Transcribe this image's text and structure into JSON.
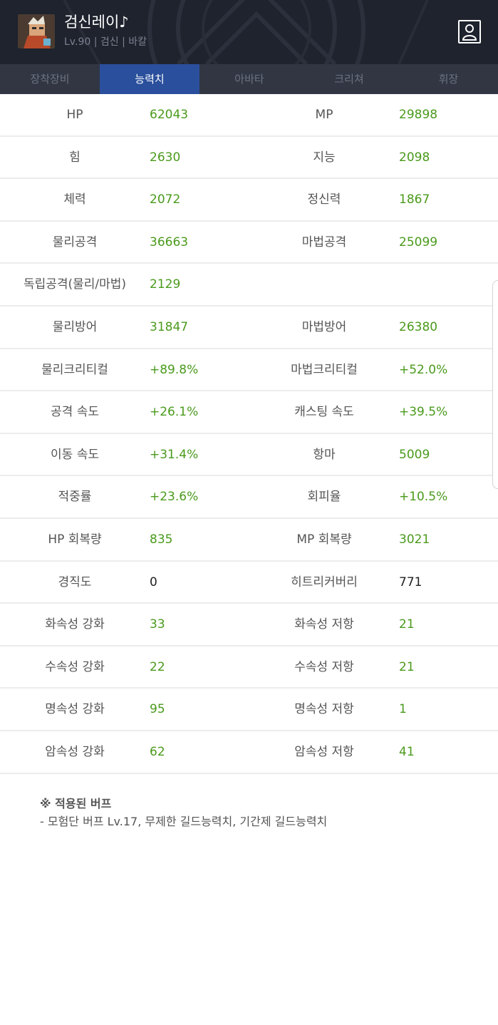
{
  "header": {
    "character_name": "검신레이♪",
    "character_info": "Lv.90 | 검신 | 바칼",
    "profile_icon": "profile-icon",
    "avatar_icon": "character-avatar"
  },
  "tabs": [
    {
      "label": "장착장비",
      "active": false
    },
    {
      "label": "능력치",
      "active": true
    },
    {
      "label": "아바타",
      "active": false
    },
    {
      "label": "크리쳐",
      "active": false
    },
    {
      "label": "휘장",
      "active": false
    }
  ],
  "stats": [
    {
      "l_label": "HP",
      "l_value": "62043",
      "r_label": "MP",
      "r_value": "29898"
    },
    {
      "l_label": "힘",
      "l_value": "2630",
      "r_label": "지능",
      "r_value": "2098"
    },
    {
      "l_label": "체력",
      "l_value": "2072",
      "r_label": "정신력",
      "r_value": "1867"
    },
    {
      "l_label": "물리공격",
      "l_value": "36663",
      "r_label": "마법공격",
      "r_value": "25099"
    },
    {
      "l_label": "독립공격(물리/마법)",
      "l_value": "2129",
      "r_label": "",
      "r_value": ""
    },
    {
      "l_label": "물리방어",
      "l_value": "31847",
      "r_label": "마법방어",
      "r_value": "26380"
    },
    {
      "l_label": "물리크리티컬",
      "l_value": "+89.8%",
      "r_label": "마법크리티컬",
      "r_value": "+52.0%"
    },
    {
      "l_label": "공격 속도",
      "l_value": "+26.1%",
      "r_label": "캐스팅 속도",
      "r_value": "+39.5%"
    },
    {
      "l_label": "이동 속도",
      "l_value": "+31.4%",
      "r_label": "항마",
      "r_value": "5009"
    },
    {
      "l_label": "적중률",
      "l_value": "+23.6%",
      "r_label": "회피율",
      "r_value": "+10.5%"
    },
    {
      "l_label": "HP 회복량",
      "l_value": "835",
      "r_label": "MP 회복량",
      "r_value": "3021"
    },
    {
      "l_label": "경직도",
      "l_value": "0",
      "r_label": "히트리커버리",
      "r_value": "771"
    },
    {
      "l_label": "화속성 강화",
      "l_value": "33",
      "r_label": "화속성 저항",
      "r_value": "21"
    },
    {
      "l_label": "수속성 강화",
      "l_value": "22",
      "r_label": "수속성 저항",
      "r_value": "21"
    },
    {
      "l_label": "명속성 강화",
      "l_value": "95",
      "r_label": "명속성 저항",
      "r_value": "1"
    },
    {
      "l_label": "암속성 강화",
      "l_value": "62",
      "r_label": "암속성 저항",
      "r_value": "41"
    }
  ],
  "buff": {
    "title": "※ 적용된 버프",
    "text": "- 모험단 버프 Lv.17, 무제한 길드능력치, 기간제 길드능력치"
  },
  "colors": {
    "header_bg": "#1f2430",
    "tab_bg": "#313642",
    "tab_active": "#2a4f9c",
    "value_green": "#4a9a1c"
  }
}
